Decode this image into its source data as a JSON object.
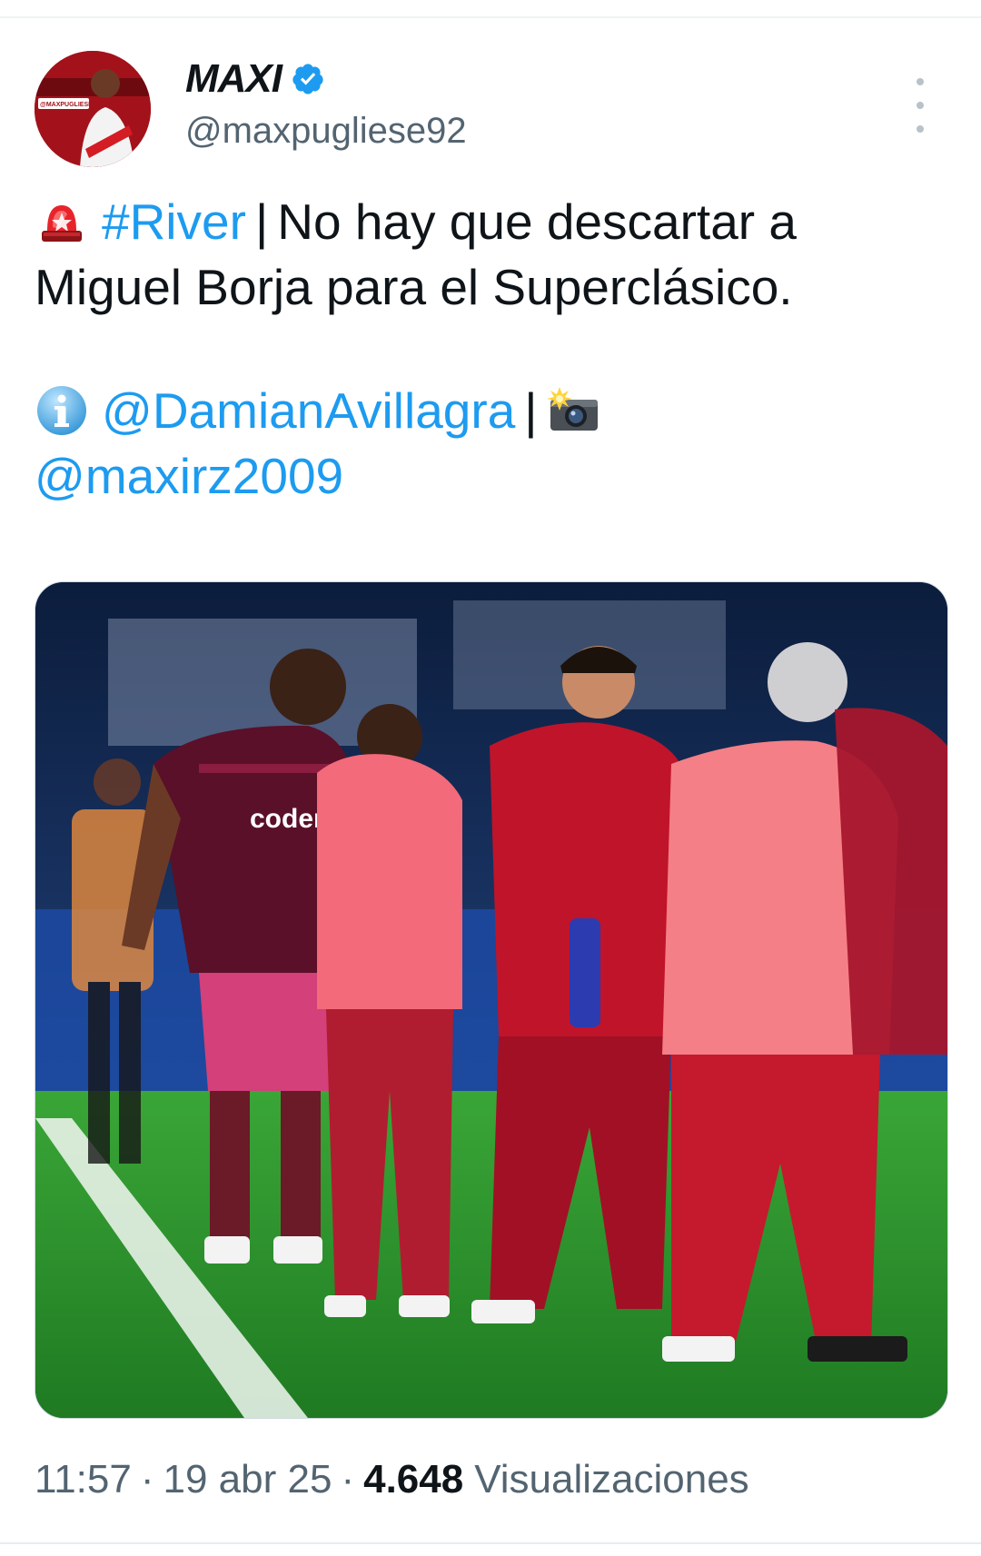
{
  "tweet": {
    "author": {
      "display_name": "MAXI",
      "handle": "@maxpugliese92",
      "verified": true,
      "avatar_text": "@MAXPUGLIESE92"
    },
    "text": {
      "siren_icon": "police-light-icon",
      "hashtag": "#River",
      "separator": "|",
      "line1_rest": "No hay que descartar a",
      "line2": "Miguel Borja para el Superclásico.",
      "info_icon": "information-icon",
      "mention1": "@DamianAvillagra",
      "separator2": "|",
      "camera_icon": "camera-flash-icon",
      "mention2": "@maxirz2009"
    },
    "media": {
      "jersey_text": "coder"
    },
    "meta": {
      "time": "11:57",
      "dot": "·",
      "date": "19 abr 25",
      "views_count": "4.648",
      "views_label": "Visualizaciones"
    }
  },
  "colors": {
    "link": "#1d9bf0",
    "text": "#0f1419",
    "secondary": "#536471",
    "verified": "#1d9bf0"
  }
}
